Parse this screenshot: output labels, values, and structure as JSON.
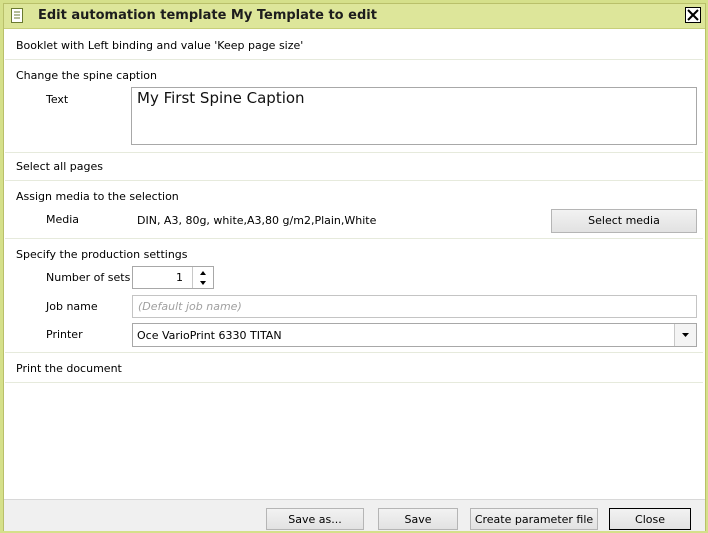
{
  "window": {
    "title": "Edit automation template My Template to edit",
    "icons": {
      "title": "document-icon",
      "close": "close-icon"
    }
  },
  "sections": {
    "booklet": "Booklet with Left binding and value 'Keep page size'",
    "spine": {
      "title": "Change the spine caption",
      "text_label": "Text",
      "text_value": "My First Spine Caption"
    },
    "select_pages": "Select all pages",
    "media": {
      "title": "Assign media to the selection",
      "label": "Media",
      "value": "DIN, A3, 80g, white,A3,80 g/m2,Plain,White",
      "button": "Select media"
    },
    "production": {
      "title": "Specify the production settings",
      "sets_label": "Number of sets",
      "sets_value": "1",
      "job_label": "Job name",
      "job_placeholder": "(Default job name)",
      "printer_label": "Printer",
      "printer_value": "Oce VarioPrint 6330 TITAN"
    },
    "print": "Print the document"
  },
  "footer": {
    "save_as": "Save as...",
    "save": "Save",
    "create_param": "Create parameter file",
    "close": "Close"
  }
}
